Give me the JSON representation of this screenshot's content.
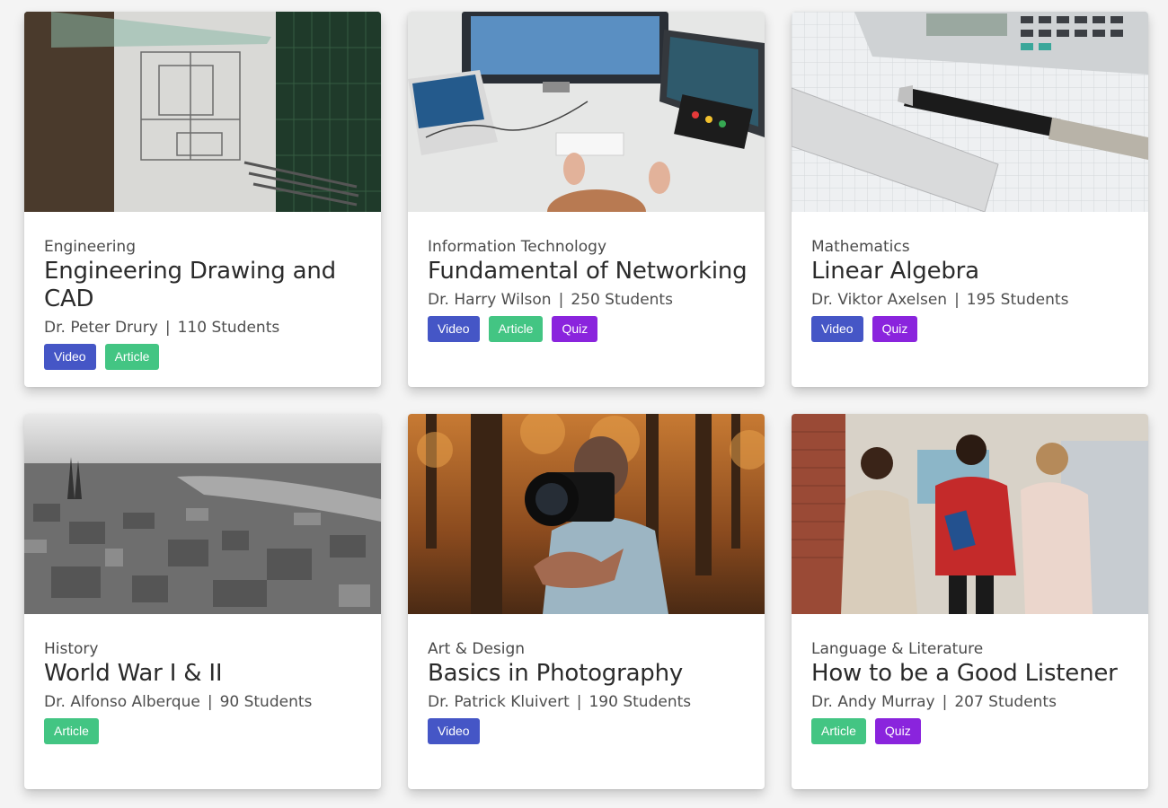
{
  "courses": [
    {
      "image": "engineering-drawing-image",
      "category": "Engineering",
      "title": "Engineering Drawing and CAD",
      "instructor": "Dr. Peter Drury",
      "students": "110 Students",
      "tags": [
        "Video",
        "Article"
      ]
    },
    {
      "image": "networking-desk-image",
      "category": "Information Technology",
      "title": "Fundamental of Networking",
      "instructor": "Dr. Harry Wilson",
      "students": "250 Students",
      "tags": [
        "Video",
        "Article",
        "Quiz"
      ]
    },
    {
      "image": "calculator-pen-image",
      "category": "Mathematics",
      "title": "Linear Algebra",
      "instructor": "Dr. Viktor Axelsen",
      "students": "195 Students",
      "tags": [
        "Video",
        "Quiz"
      ]
    },
    {
      "image": "war-ruins-aerial-image",
      "category": "History",
      "title": "World War I & II",
      "instructor": "Dr. Alfonso Alberque",
      "students": "90 Students",
      "tags": [
        "Article"
      ]
    },
    {
      "image": "photographer-camera-image",
      "category": "Art & Design",
      "title": "Basics in Photography",
      "instructor": "Dr. Patrick Kluivert",
      "students": "190 Students",
      "tags": [
        "Video"
      ]
    },
    {
      "image": "three-women-walking-image",
      "category": "Language & Literature",
      "title": "How to be a Good Listener",
      "instructor": "Dr. Andy Murray",
      "students": "207 Students",
      "tags": [
        "Article",
        "Quiz"
      ]
    }
  ],
  "meta_separator": "|",
  "colors": {
    "video": "#4556c6",
    "article": "#43c583",
    "quiz": "#8a24dd"
  }
}
